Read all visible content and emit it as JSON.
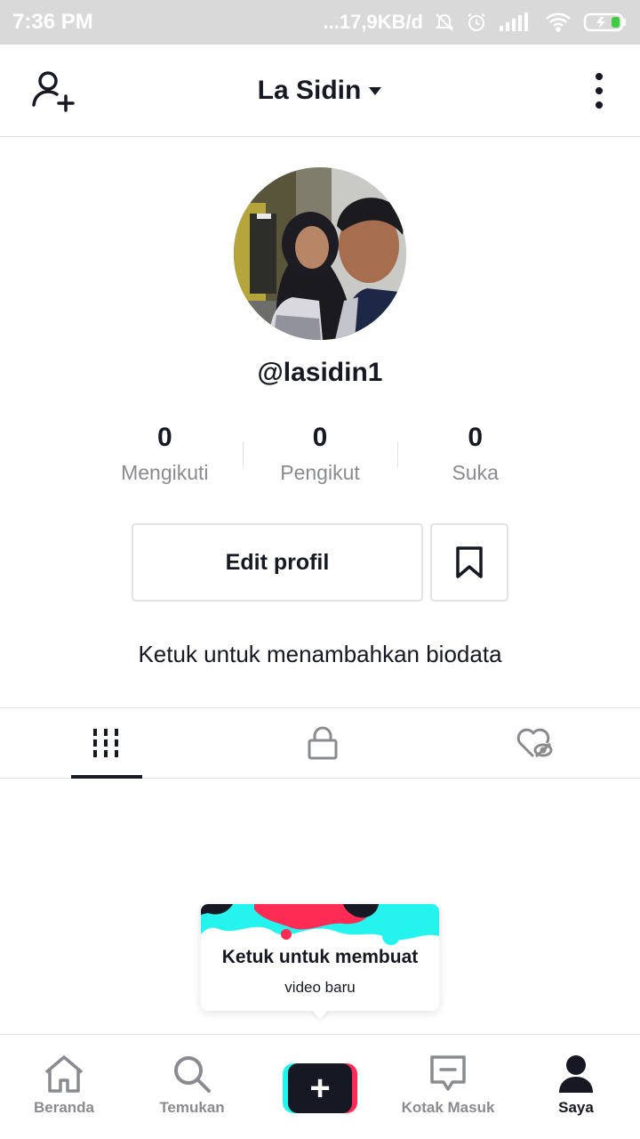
{
  "status_bar": {
    "time": "7:36 PM",
    "network_speed": "...17,9KB/d",
    "icons": [
      "mute-icon",
      "alarm-icon",
      "signal-icon",
      "wifi-icon",
      "battery-charging-icon"
    ]
  },
  "header": {
    "title": "La Sidin",
    "left_icon": "add-user-icon",
    "right_icon": "more-vertical-icon",
    "title_icon": "caret-down-icon"
  },
  "profile": {
    "username": "@lasidin1",
    "stats": [
      {
        "value": "0",
        "label": "Mengikuti"
      },
      {
        "value": "0",
        "label": "Pengikut"
      },
      {
        "value": "0",
        "label": "Suka"
      }
    ],
    "edit_button": "Edit profil",
    "bookmark_icon": "bookmark-icon",
    "bio_prompt": "Ketuk untuk menambahkan biodata"
  },
  "tabs": [
    {
      "icon": "grid-icon",
      "active": true
    },
    {
      "icon": "lock-icon",
      "active": false
    },
    {
      "icon": "hidden-liked-icon",
      "active": false
    }
  ],
  "tooltip": {
    "title": "Ketuk untuk membuat",
    "subtitle": "video baru"
  },
  "bottom_nav": [
    {
      "label": "Beranda",
      "icon": "home-icon",
      "active": false
    },
    {
      "label": "Temukan",
      "icon": "search-icon",
      "active": false
    },
    {
      "label": "",
      "icon": "plus-icon",
      "active": false
    },
    {
      "label": "Kotak Masuk",
      "icon": "inbox-icon",
      "active": false
    },
    {
      "label": "Saya",
      "icon": "profile-icon",
      "active": true
    }
  ],
  "colors": {
    "text_primary": "#161823",
    "text_secondary": "#8a8b91",
    "divider": "#e3e3e4",
    "accent_cyan": "#25f4ee",
    "accent_red": "#fe2c55"
  }
}
